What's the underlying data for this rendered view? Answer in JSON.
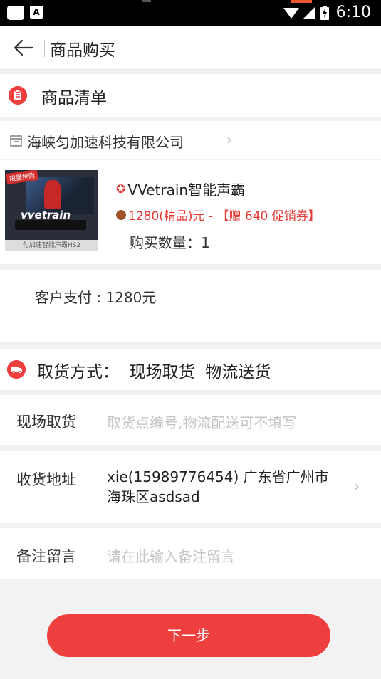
{
  "status_bar": {
    "time": "6:10",
    "notification_label": "A"
  },
  "header": {
    "title": "商品购买"
  },
  "goods_list": {
    "title": "商品清单"
  },
  "store": {
    "name": "海峡匀加速科技有限公司"
  },
  "product": {
    "image_brand": "vvetrain",
    "image_caption": "匀加速智能声霸HS2",
    "image_ribbon": "限量抢购",
    "name": "VVetrain智能声霸",
    "price_text": "1280(精品)元 - 【赠 640 促销券】",
    "quantity_text": "购买数量：1"
  },
  "payment": {
    "text": "客户支付 : 1280元"
  },
  "pickup": {
    "title": "取货方式：  现场取货  物流送货"
  },
  "form": {
    "pickup_label": "现场取货",
    "pickup_placeholder": "取货点编号,物流配送可不填写",
    "address_label": "收货地址",
    "address_value": "xie(15989776454)  广东省广州市海珠区asdsad",
    "note_label": "备注留言",
    "note_placeholder": "请在此输入备注留言"
  },
  "actions": {
    "next_label": "下一步"
  },
  "colors": {
    "accent": "#ee3f3f",
    "price": "#e53935"
  }
}
